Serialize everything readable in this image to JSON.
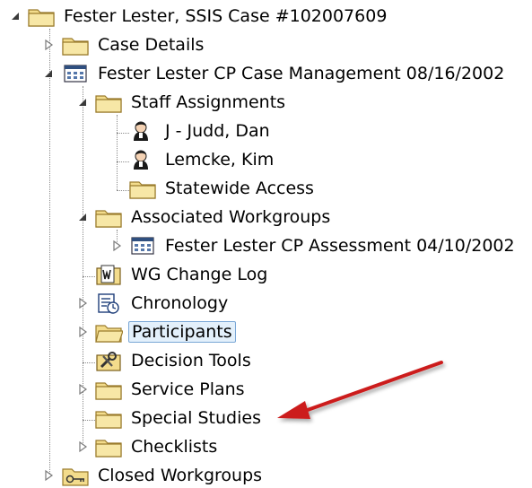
{
  "tree": {
    "root": "Fester Lester, SSIS Case #102007609",
    "case_details": "Case Details",
    "case_mgmt": "Fester Lester CP Case Management 08/16/2002",
    "staff_assignments": "Staff Assignments",
    "staff_1": "J - Judd, Dan",
    "staff_2": "Lemcke, Kim",
    "statewide_access": "Statewide Access",
    "associated_workgroups": "Associated Workgroups",
    "assessment": "Fester Lester CP Assessment 04/10/2002",
    "wg_change_log": "WG Change Log",
    "chronology": "Chronology",
    "participants": "Participants",
    "decision_tools": "Decision Tools",
    "service_plans": "Service Plans",
    "special_studies": "Special Studies",
    "checklists": "Checklists",
    "closed_workgroups": "Closed Workgroups"
  },
  "icons": {
    "folder": "folder-icon",
    "case_grid": "case-grid-icon",
    "person": "person-icon",
    "notebook": "notebook-icon",
    "chronology": "chronology-icon",
    "tools": "decision-tools-icon",
    "key_folder": "key-folder-icon",
    "expanded": "expanded-triangle-icon",
    "collapsed": "collapsed-triangle-icon"
  },
  "colors": {
    "selection_bg": "#e3f0fb",
    "selection_border": "#7aa7d6",
    "annotation_arrow": "#cc1f1f",
    "folder_fill": "#f3dc8c"
  }
}
